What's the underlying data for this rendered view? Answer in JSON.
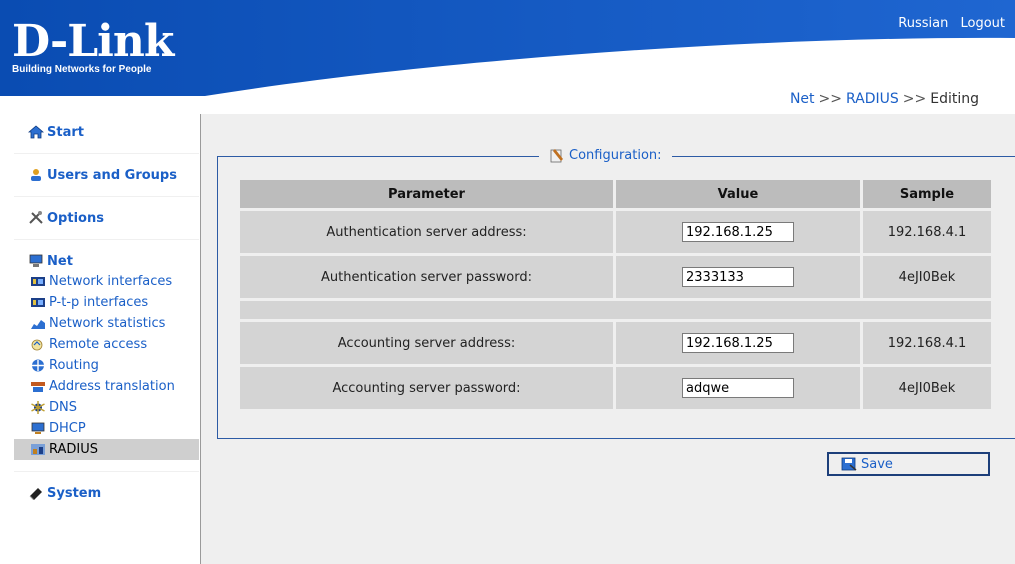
{
  "header": {
    "logo_text": "D-Link",
    "tagline": "Building Networks for People",
    "links": [
      "Russian",
      "Logout"
    ]
  },
  "breadcrumb": {
    "items": [
      "Net",
      "RADIUS",
      "Editing"
    ],
    "separator": ">>"
  },
  "sidebar": {
    "start": "Start",
    "users_and_groups": "Users and Groups",
    "options": "Options",
    "net": "Net",
    "net_items": [
      "Network interfaces",
      "P-t-p interfaces",
      "Network statistics",
      "Remote access",
      "Routing",
      "Address translation",
      "DNS",
      "DHCP",
      "RADIUS"
    ],
    "active_item": "RADIUS",
    "system": "System"
  },
  "config": {
    "legend": "Configuration:",
    "columns": [
      "Parameter",
      "Value",
      "Sample"
    ],
    "rows": [
      {
        "parameter": "Authentication server address:",
        "value": "192.168.1.25",
        "sample": "192.168.4.1"
      },
      {
        "parameter": "Authentication server password:",
        "value": "2333133",
        "sample": "4eJI0Bek"
      },
      {
        "parameter": "Accounting server address:",
        "value": "192.168.1.25",
        "sample": "192.168.4.1"
      },
      {
        "parameter": "Accounting server password:",
        "value": "adqwe",
        "sample": "4eJI0Bek"
      }
    ],
    "save_label": "Save"
  },
  "colors": {
    "header_blue": "#1559c0",
    "link_blue": "#1a5fc7",
    "panel_bg": "#efefef"
  }
}
